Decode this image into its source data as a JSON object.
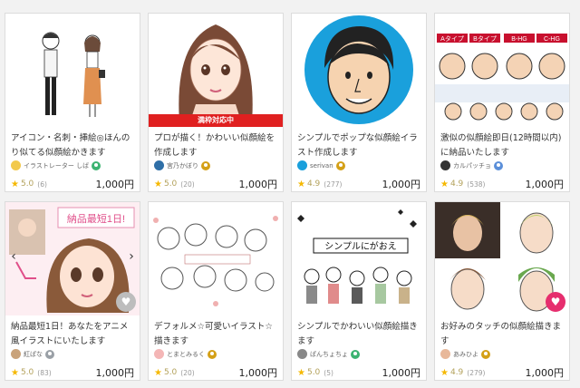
{
  "cards": [
    {
      "title": "アイコン・名刺・挿絵◎ほんのり似てる似顔絵かきます",
      "seller": "イラストレーター しば",
      "rating": "5.0",
      "reviews": "(6)",
      "price": "1,000円",
      "avatar_color": "#f2c94c",
      "rank_color": "#3cb371"
    },
    {
      "title": "プロが描く！かわいい似顔絵を作成します",
      "seller": "宮乃かぼり",
      "rating": "5.0",
      "reviews": "(20)",
      "price": "1,000円",
      "avatar_color": "#2f6fa7",
      "rank_color": "#d4a017",
      "ribbon": "満枠対応中"
    },
    {
      "title": "シンプルでポップな似顔絵イラスト作成します",
      "seller": "serivan",
      "rating": "4.9",
      "reviews": "(277)",
      "price": "1,000円",
      "avatar_color": "#1aa0dc",
      "rank_color": "#d4a017"
    },
    {
      "title": "激似の似顔絵即日(12時間以内)に納品いたします",
      "seller": "カルパッチョ",
      "rating": "4.9",
      "reviews": "(538)",
      "price": "1,000円",
      "avatar_color": "#333333",
      "rank_color": "#5b8fd9",
      "thumb_labels": [
        "Aタイプ",
        "Bタイプ",
        "B-HG",
        "C-HG"
      ]
    },
    {
      "title": "納品最短1日！あなたをアニメ風イラストにいたします",
      "seller": "紅ぱな",
      "rating": "5.0",
      "reviews": "(83)",
      "price": "1,000円",
      "avatar_color": "#c9a37b",
      "rank_color": "#9aa0a6",
      "thumb_banner": "納品最短1日!"
    },
    {
      "title": "デフォルメ☆可愛いイラスト☆描きます",
      "seller": "とまとみるく",
      "rating": "5.0",
      "reviews": "(20)",
      "price": "1,000円",
      "avatar_color": "#f4b6b6",
      "rank_color": "#d4a017"
    },
    {
      "title": "シンプルでかわいい似顔絵描きます",
      "seller": "ぱんちょちょ",
      "rating": "5.0",
      "reviews": "(5)",
      "price": "1,000円",
      "avatar_color": "#888888",
      "rank_color": "#3cb371",
      "thumb_banner": "シンプルにがおえ"
    },
    {
      "title": "お好みのタッチの似顔絵描きます",
      "seller": "あみひよ",
      "rating": "4.9",
      "reviews": "(279)",
      "price": "1,000円",
      "avatar_color": "#e8b89a",
      "rank_color": "#d4a017"
    }
  ],
  "icons": {
    "star": "star-icon",
    "favorite": "heart-icon"
  }
}
